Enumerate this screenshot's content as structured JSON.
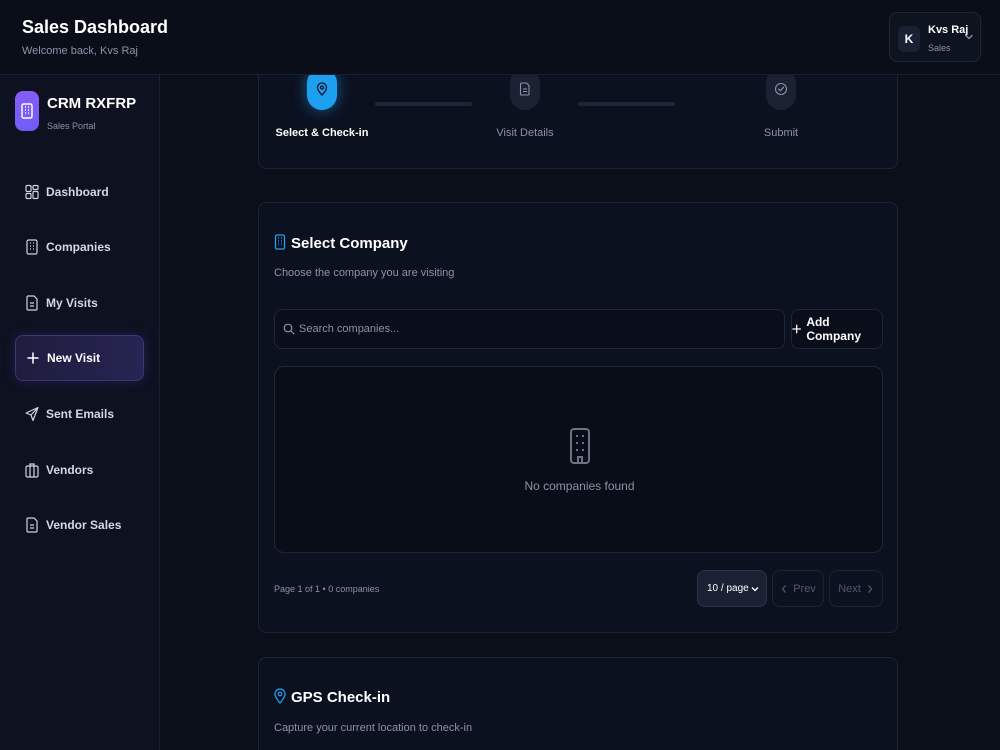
{
  "header": {
    "title": "Sales Dashboard",
    "subtitle": "Welcome back, Kvs Raj",
    "user": {
      "initial": "K",
      "name": "Kvs Raj",
      "role": "Sales"
    }
  },
  "sidebar": {
    "brand": {
      "name": "CRM RXFRP",
      "subtitle": "Sales Portal"
    },
    "items": [
      {
        "label": "Dashboard",
        "icon": "dashboard-grid-icon",
        "active": false
      },
      {
        "label": "Companies",
        "icon": "building-icon",
        "active": false
      },
      {
        "label": "My Visits",
        "icon": "document-icon",
        "active": false
      },
      {
        "label": "New Visit",
        "icon": "plus-icon",
        "active": true
      },
      {
        "label": "Sent Emails",
        "icon": "send-icon",
        "active": false
      },
      {
        "label": "Vendors",
        "icon": "briefcase-icon",
        "active": false
      },
      {
        "label": "Vendor Sales",
        "icon": "document-icon",
        "active": false
      }
    ]
  },
  "stepper": {
    "steps": [
      {
        "label": "Select & Check-in",
        "icon": "map-pin-icon",
        "state": "active"
      },
      {
        "label": "Visit Details",
        "icon": "document-icon",
        "state": "pending"
      },
      {
        "label": "Submit",
        "icon": "check-circle-icon",
        "state": "pending"
      }
    ]
  },
  "select_company": {
    "title": "Select Company",
    "subtitle": "Choose the company you are visiting",
    "search_placeholder": "Search companies...",
    "add_label": "Add Company",
    "empty_text": "No companies found",
    "pager_info": "Page 1 of 1 • 0 companies",
    "per_page": "10 / page",
    "prev_label": "Prev",
    "next_label": "Next"
  },
  "gps": {
    "title": "GPS Check-in",
    "subtitle": "Capture your current location to check-in"
  },
  "colors": {
    "accent_blue": "#1ea0f0",
    "accent_purple": "#7c5cf6",
    "background": "#0b0f1a"
  }
}
